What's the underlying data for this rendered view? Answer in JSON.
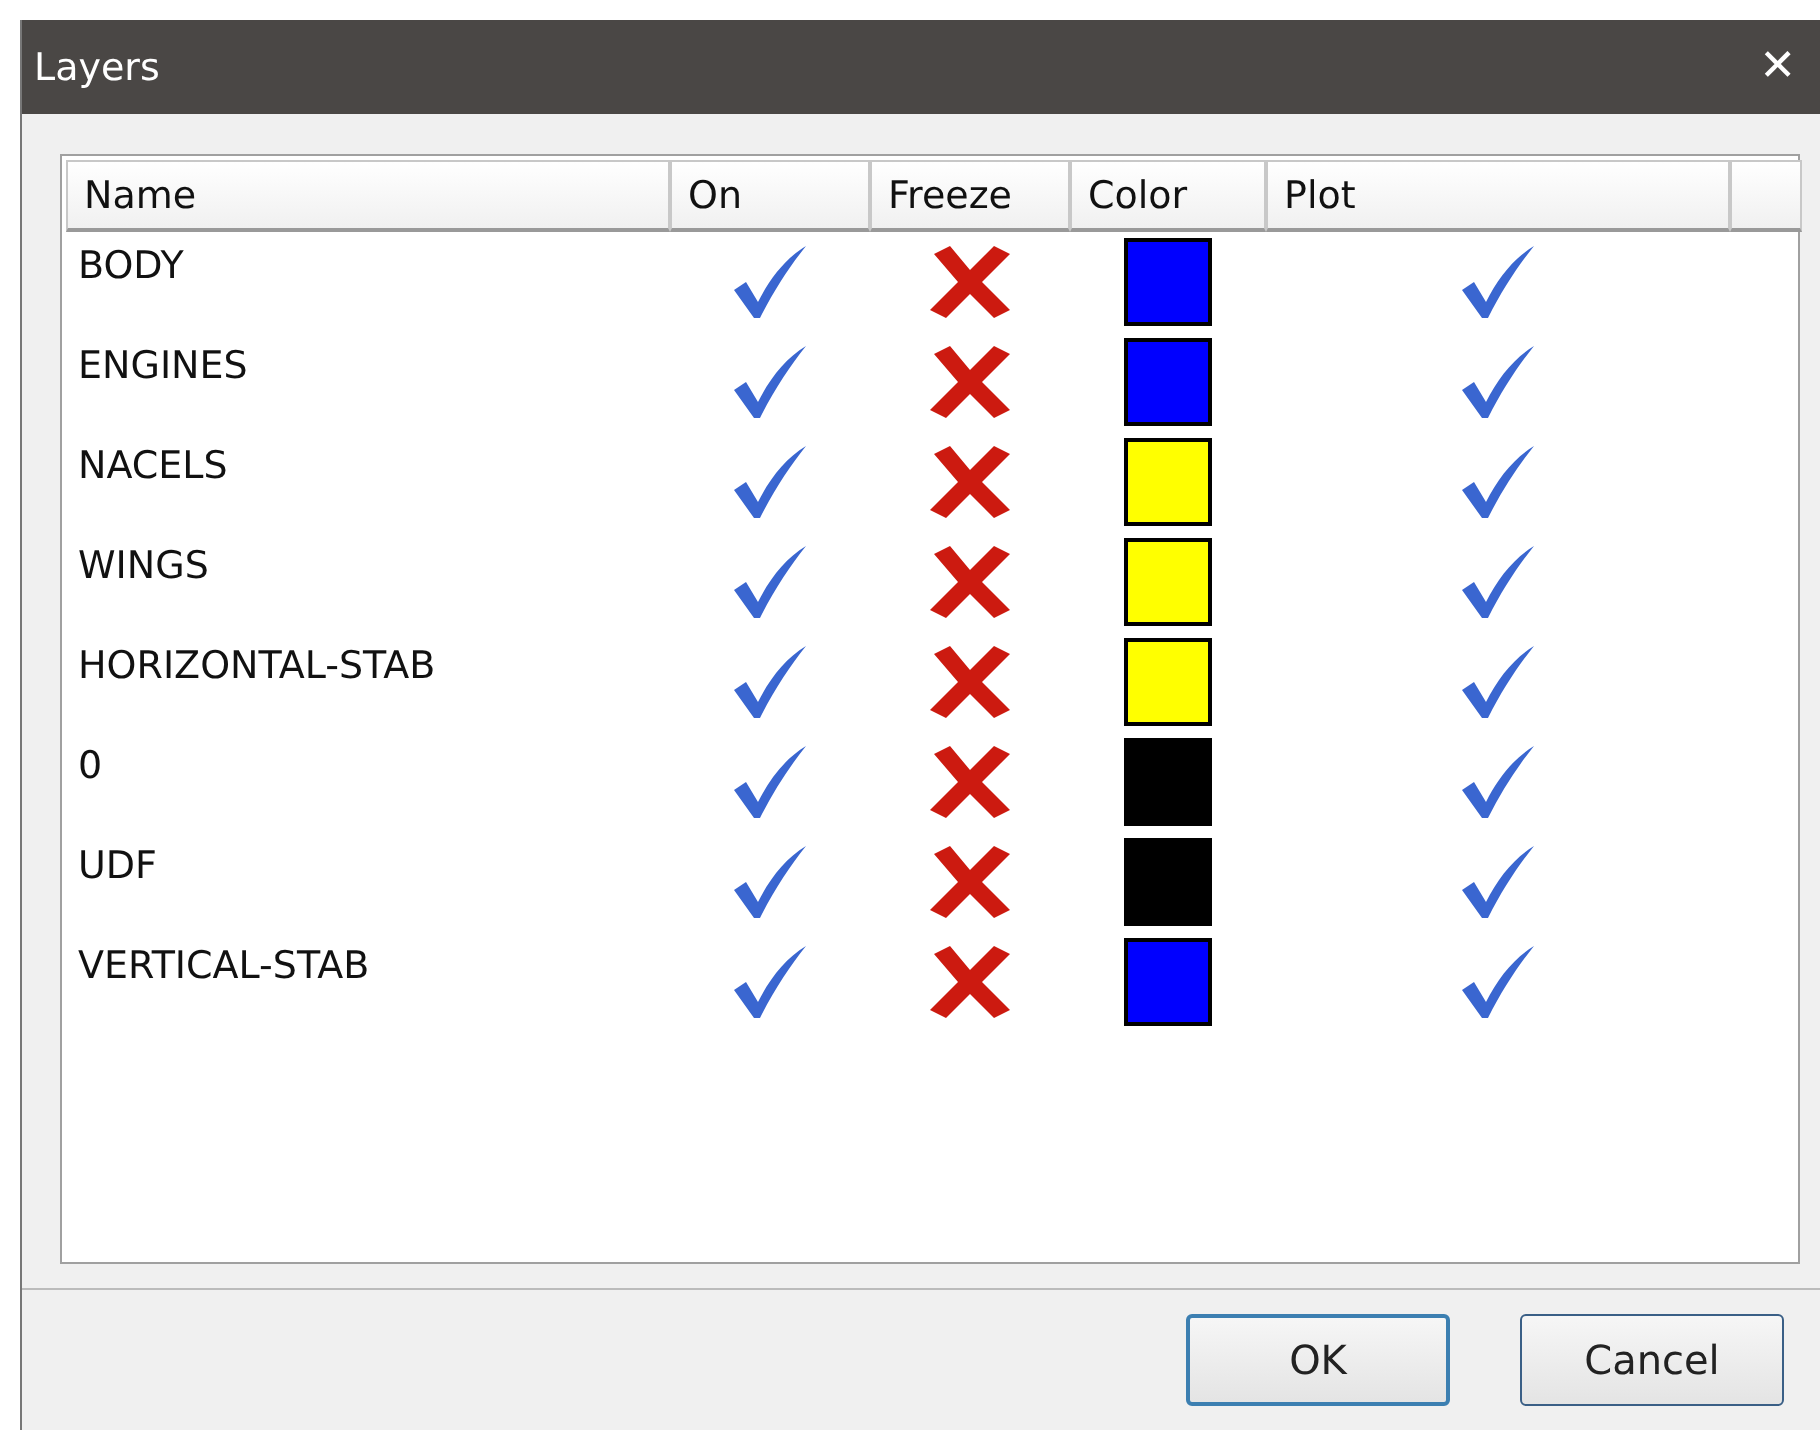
{
  "window": {
    "title": "Layers",
    "close": "✕"
  },
  "table": {
    "columns": [
      "Name",
      "On",
      "Freeze",
      "Color",
      "Plot"
    ],
    "rows": [
      {
        "name": "BODY",
        "on": true,
        "frozen": false,
        "color": "#0000ff",
        "plot": true
      },
      {
        "name": "ENGINES",
        "on": true,
        "frozen": false,
        "color": "#0000ff",
        "plot": true
      },
      {
        "name": "NACELS",
        "on": true,
        "frozen": false,
        "color": "#ffff00",
        "plot": true
      },
      {
        "name": "WINGS",
        "on": true,
        "frozen": false,
        "color": "#ffff00",
        "plot": true
      },
      {
        "name": "HORIZONTAL-STAB",
        "on": true,
        "frozen": false,
        "color": "#ffff00",
        "plot": true
      },
      {
        "name": "0",
        "on": true,
        "frozen": false,
        "color": "#000000",
        "plot": true
      },
      {
        "name": "UDF",
        "on": true,
        "frozen": false,
        "color": "#000000",
        "plot": true
      },
      {
        "name": "VERTICAL-STAB",
        "on": true,
        "frozen": false,
        "color": "#0000ff",
        "plot": true
      }
    ]
  },
  "buttons": [
    {
      "label": "OK",
      "default": true
    },
    {
      "label": "Cancel",
      "default": false
    }
  ]
}
